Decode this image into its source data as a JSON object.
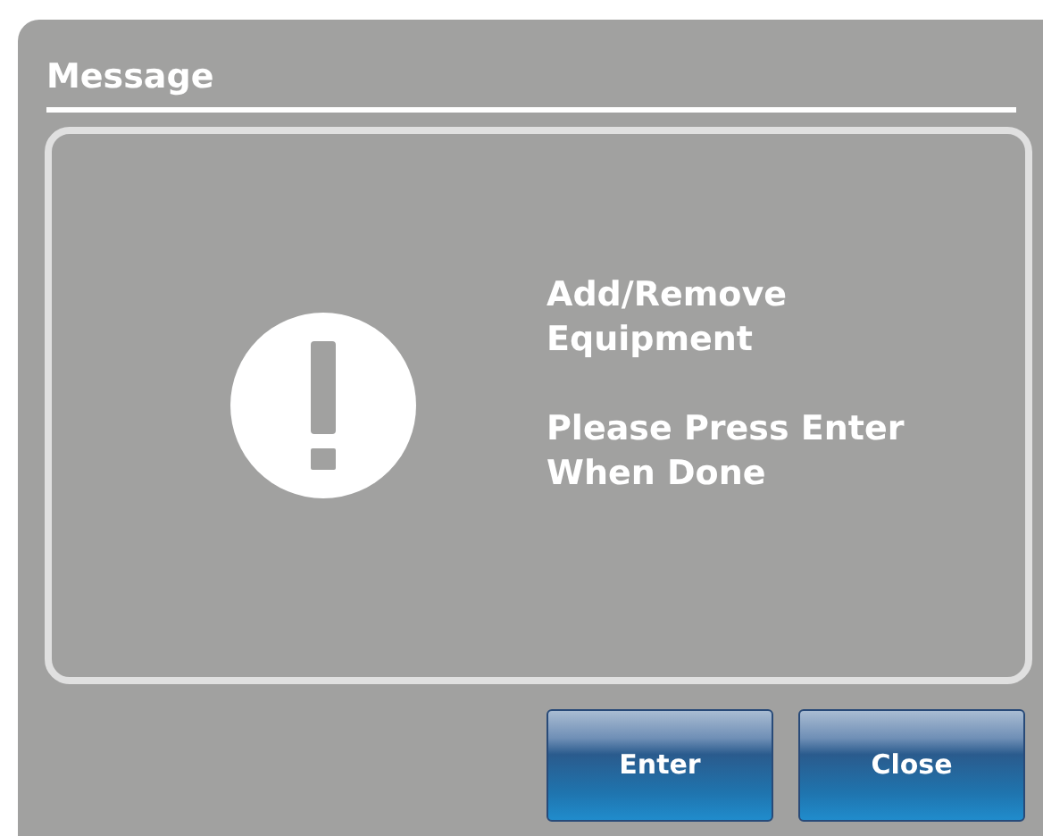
{
  "dialog": {
    "title": "Message",
    "paragraphs": [
      "Add/Remove Equipment",
      "Please Press Enter When Done"
    ]
  },
  "buttons": [
    {
      "label": "Enter"
    },
    {
      "label": "Close"
    }
  ]
}
